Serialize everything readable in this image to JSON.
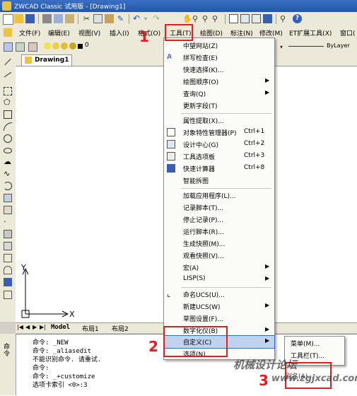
{
  "window": {
    "title": "ZWCAD Classic 试用版 - [Drawing1]"
  },
  "menubar": {
    "items": [
      "文件(F)",
      "编辑(E)",
      "视图(V)",
      "插入(I)",
      "格式(O)",
      "工具(T)",
      "绘图(D)",
      "标注(N)",
      "修改(M)",
      "ET扩展工具(X)",
      "窗口("
    ]
  },
  "layer_toolbar": {
    "layer_value": "0",
    "linetype_value": "ByLayer"
  },
  "document_tab": {
    "label": "Drawing1"
  },
  "layout_tabs": [
    "Model",
    "布局1",
    "布局2"
  ],
  "ucs_icon": {
    "x_label": "X",
    "y_label": "Y"
  },
  "command_panel": {
    "side_label": "命令",
    "lines": [
      "命令: _NEW",
      "命令: _aliasedit",
      "不能识别命令.  请重试.",
      "命令:",
      "命令: _+customize",
      "选项卡索引 <0>:3"
    ]
  },
  "tools_menu": {
    "items": [
      {
        "label": "中望网站(Z)",
        "shortcut": "",
        "submenu": false,
        "icon": ""
      },
      {
        "label": "拼写检查(E)",
        "shortcut": "",
        "submenu": false,
        "icon": "spell-check-icon"
      },
      {
        "label": "快速选择(K)...",
        "shortcut": "",
        "submenu": false,
        "icon": ""
      },
      {
        "label": "绘图顺序(O)",
        "shortcut": "",
        "submenu": true,
        "icon": ""
      },
      {
        "label": "查询(Q)",
        "shortcut": "",
        "submenu": true,
        "icon": ""
      },
      {
        "label": "更新字段(T)",
        "shortcut": "",
        "submenu": false,
        "icon": ""
      },
      {
        "label": "属性提取(X)...",
        "shortcut": "",
        "submenu": false,
        "icon": ""
      },
      {
        "label": "对象特性管理器(P)",
        "shortcut": "Ctrl+1",
        "submenu": false,
        "icon": "properties-icon"
      },
      {
        "label": "设计中心(G)",
        "shortcut": "Ctrl+2",
        "submenu": false,
        "icon": "design-center-icon"
      },
      {
        "label": "工具选项板",
        "shortcut": "Ctrl+3",
        "submenu": false,
        "icon": "tool-palette-icon"
      },
      {
        "label": "快速计算器",
        "shortcut": "Ctrl+8",
        "submenu": false,
        "icon": "calculator-icon"
      },
      {
        "label": "智能拆图",
        "shortcut": "",
        "submenu": false,
        "icon": ""
      },
      {
        "label": "加载应用程序(L)...",
        "shortcut": "",
        "submenu": false,
        "icon": ""
      },
      {
        "label": "记录脚本(T)...",
        "shortcut": "",
        "submenu": false,
        "icon": ""
      },
      {
        "label": "停止记录(P)...",
        "shortcut": "",
        "submenu": false,
        "icon": ""
      },
      {
        "label": "运行脚本(R)...",
        "shortcut": "",
        "submenu": false,
        "icon": ""
      },
      {
        "label": "生成快照(M)...",
        "shortcut": "",
        "submenu": false,
        "icon": ""
      },
      {
        "label": "观看快照(V)...",
        "shortcut": "",
        "submenu": false,
        "icon": ""
      },
      {
        "label": "宏(A)",
        "shortcut": "",
        "submenu": true,
        "icon": ""
      },
      {
        "label": "LISP(S)",
        "shortcut": "",
        "submenu": true,
        "icon": ""
      },
      {
        "label": "命名UCS(U)...",
        "shortcut": "",
        "submenu": false,
        "icon": "named-ucs-icon"
      },
      {
        "label": "新建UCS(W)",
        "shortcut": "",
        "submenu": true,
        "icon": ""
      },
      {
        "label": "草图设置(F)...",
        "shortcut": "",
        "submenu": false,
        "icon": ""
      },
      {
        "label": "数字化仪(B)",
        "shortcut": "",
        "submenu": true,
        "icon": ""
      },
      {
        "label": "自定义(C)",
        "shortcut": "",
        "submenu": true,
        "icon": ""
      },
      {
        "label": "选项(N)...",
        "shortcut": "",
        "submenu": false,
        "icon": ""
      }
    ]
  },
  "customize_submenu": {
    "items": [
      "菜单(M)...",
      "工具栏(T)...",
      "别名(A)..."
    ]
  },
  "annotations": {
    "step1": "1",
    "step2": "2",
    "step3": "3"
  },
  "watermark": {
    "line1": "机械设计论坛",
    "line2": "www.zgjxcad.com"
  }
}
